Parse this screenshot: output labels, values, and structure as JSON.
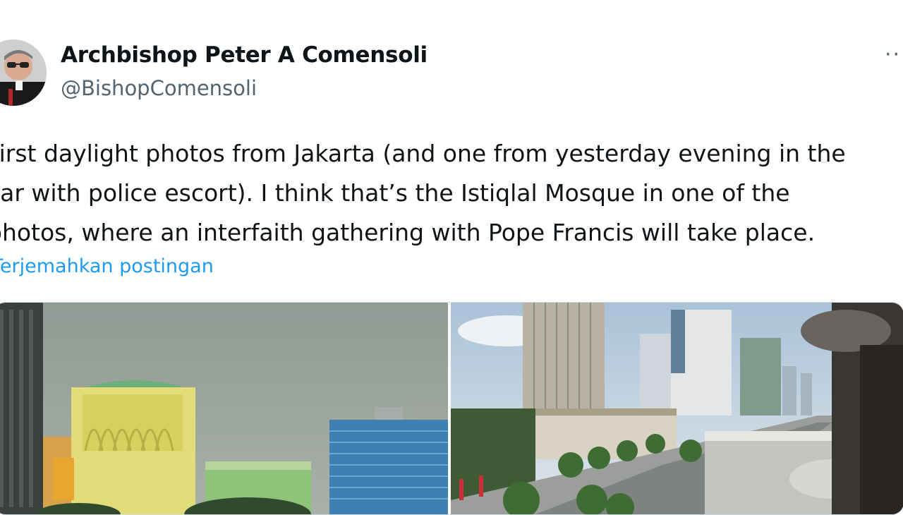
{
  "author": {
    "name": "Archbishop Peter A Comensoli",
    "handle": "@BishopComensoli"
  },
  "tweet": {
    "lines": [
      "First daylight photos from Jakarta (and one from yesterday evening in the",
      "car with police escort). I think that’s the Istiqlal Mosque in one of the",
      "photos, where an interfaith gathering with Pope Francis will take place."
    ],
    "translate_label": "Terjemahkan postingan"
  },
  "more_label": "···",
  "icons": {
    "more": "more-options-icon"
  },
  "colors": {
    "link": "#1d9bf0",
    "secondary_text": "#536471",
    "primary_text": "#0f1419"
  }
}
